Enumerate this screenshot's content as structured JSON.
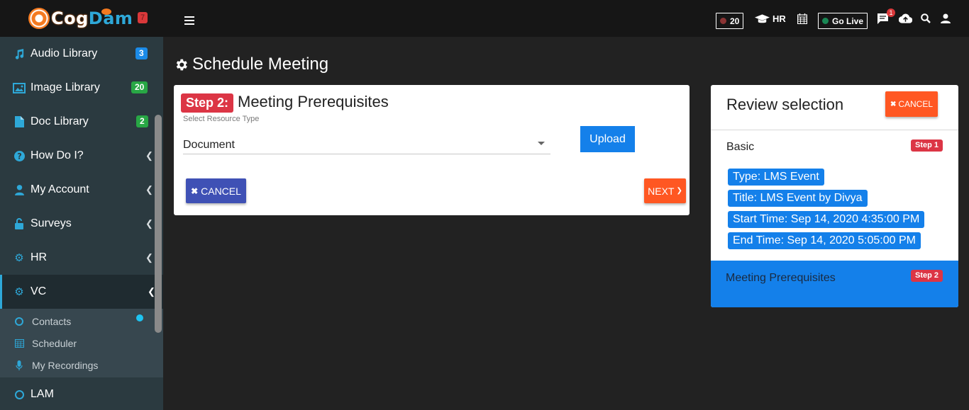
{
  "brand": {
    "part1": "Cog",
    "part2": "Dam",
    "badge": "7"
  },
  "sidebar": {
    "items": [
      {
        "label": "Audio Library",
        "badge": "3",
        "badge_color": "#1b8be8"
      },
      {
        "label": "Image Library",
        "badge": "20",
        "badge_color": "#28a745"
      },
      {
        "label": "Doc Library",
        "badge": "2",
        "badge_color": "#28a745"
      },
      {
        "label": "How Do I?"
      },
      {
        "label": "My Account"
      },
      {
        "label": "Surveys"
      },
      {
        "label": "HR"
      },
      {
        "label": "VC"
      },
      {
        "label": "LAM"
      }
    ],
    "vc_submenu": [
      {
        "label": "Contacts"
      },
      {
        "label": "Scheduler"
      },
      {
        "label": "My Recordings"
      }
    ]
  },
  "topbar": {
    "counter": "20",
    "hr_label": "HR",
    "go_live_label": "Go Live",
    "notification_count": "1"
  },
  "page": {
    "title": "Schedule Meeting"
  },
  "step_card": {
    "step_tag": "Step 2:",
    "title": "Meeting Prerequisites",
    "field_label": "Select Resource Type",
    "selected_value": "Document",
    "upload_label": "Upload",
    "cancel_label": "CANCEL",
    "next_label": "NEXT"
  },
  "review": {
    "title": "Review selection",
    "cancel_label": "CANCEL",
    "basic": {
      "title": "Basic",
      "step_badge": "Step 1",
      "chips": [
        "Type: LMS Event",
        "Title: LMS Event by Divya",
        "Start Time: Sep 14, 2020 4:35:00 PM",
        "End Time: Sep 14, 2020 5:05:00 PM"
      ]
    },
    "prerequisites": {
      "title": "Meeting Prerequisites",
      "step_badge": "Step 2"
    }
  },
  "colors": {
    "accent_blue": "#1480ea",
    "danger_red": "#dc3545",
    "orange": "#ff5722",
    "indigo": "#3f51b5"
  }
}
